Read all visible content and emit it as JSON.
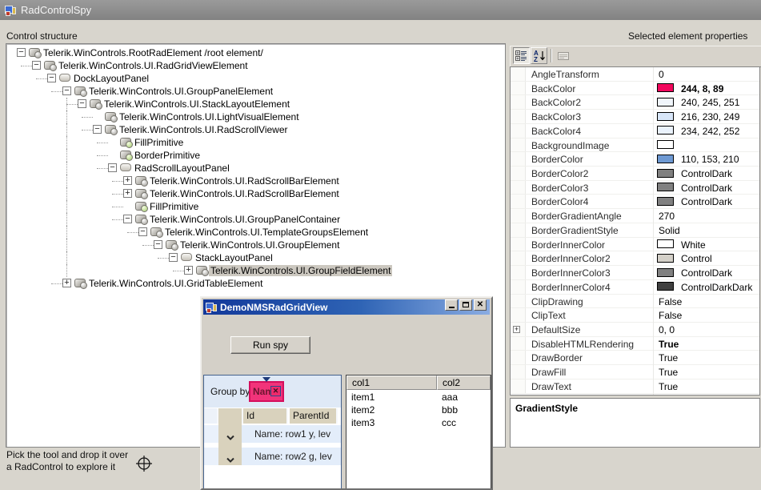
{
  "window": {
    "title": "RadControlSpy"
  },
  "labels": {
    "control_structure": "Control structure",
    "selected_properties": "Selected element properties"
  },
  "tree": {
    "nodes": [
      {
        "label": "Telerik.WinControls.RootRadElement /root element/",
        "level": 0,
        "state": "minus",
        "icon": "element"
      },
      {
        "label": "Telerik.WinControls.UI.RadGridViewElement",
        "level": 1,
        "state": "minus",
        "icon": "element"
      },
      {
        "label": "DockLayoutPanel",
        "level": 2,
        "state": "minus",
        "icon": "panel"
      },
      {
        "label": "Telerik.WinControls.UI.GroupPanelElement",
        "level": 3,
        "state": "minus",
        "icon": "element"
      },
      {
        "label": "Telerik.WinControls.UI.StackLayoutElement",
        "level": 4,
        "state": "minus",
        "icon": "element"
      },
      {
        "label": "Telerik.WinControls.UI.LightVisualElement",
        "level": 5,
        "state": "leaf",
        "icon": "element"
      },
      {
        "label": "Telerik.WinControls.UI.RadScrollViewer",
        "level": 5,
        "state": "minus",
        "icon": "element"
      },
      {
        "label": "FillPrimitive",
        "level": 6,
        "state": "leaf",
        "icon": "primitive"
      },
      {
        "label": "BorderPrimitive",
        "level": 6,
        "state": "leaf",
        "icon": "primitive"
      },
      {
        "label": "RadScrollLayoutPanel",
        "level": 6,
        "state": "minus",
        "icon": "panel"
      },
      {
        "label": "Telerik.WinControls.UI.RadScrollBarElement",
        "level": 7,
        "state": "plus",
        "icon": "element"
      },
      {
        "label": "Telerik.WinControls.UI.RadScrollBarElement",
        "level": 7,
        "state": "plus",
        "icon": "element"
      },
      {
        "label": "FillPrimitive",
        "level": 7,
        "state": "leaf",
        "icon": "primitive"
      },
      {
        "label": "Telerik.WinControls.UI.GroupPanelContainer",
        "level": 7,
        "state": "minus",
        "icon": "element"
      },
      {
        "label": "Telerik.WinControls.UI.TemplateGroupsElement",
        "level": 8,
        "state": "minus",
        "icon": "element"
      },
      {
        "label": "Telerik.WinControls.UI.GroupElement",
        "level": 9,
        "state": "minus",
        "icon": "element"
      },
      {
        "label": "StackLayoutPanel",
        "level": 10,
        "state": "minus",
        "icon": "panel"
      },
      {
        "label": "Telerik.WinControls.UI.GroupFieldElement",
        "level": 11,
        "state": "plus",
        "icon": "element",
        "selected": true
      },
      {
        "label": "Telerik.WinControls.UI.GridTableElement",
        "level": 3,
        "state": "plus",
        "icon": "element"
      }
    ]
  },
  "properties": {
    "rows": [
      {
        "name": "AngleTransform",
        "value": "0"
      },
      {
        "name": "BackColor",
        "swatch": "#f2075c",
        "value": "244, 8, 89",
        "bold": true
      },
      {
        "name": "BackColor2",
        "swatch": "#f0f5fb",
        "value": "240, 245, 251"
      },
      {
        "name": "BackColor3",
        "swatch": "#d8e6f9",
        "value": "216, 230, 249"
      },
      {
        "name": "BackColor4",
        "swatch": "#eaf2fc",
        "value": "234, 242, 252"
      },
      {
        "name": "BackgroundImage",
        "swatch": "#ffffff",
        "value": ""
      },
      {
        "name": "BorderColor",
        "swatch": "#6e99d2",
        "value": "110, 153, 210"
      },
      {
        "name": "BorderColor2",
        "swatch": "#808080",
        "value": "ControlDark"
      },
      {
        "name": "BorderColor3",
        "swatch": "#808080",
        "value": "ControlDark"
      },
      {
        "name": "BorderColor4",
        "swatch": "#808080",
        "value": "ControlDark"
      },
      {
        "name": "BorderGradientAngle",
        "value": "270"
      },
      {
        "name": "BorderGradientStyle",
        "value": "Solid"
      },
      {
        "name": "BorderInnerColor",
        "swatch": "#ffffff",
        "value": "White"
      },
      {
        "name": "BorderInnerColor2",
        "swatch": "#d4d0c8",
        "value": "Control"
      },
      {
        "name": "BorderInnerColor3",
        "swatch": "#808080",
        "value": "ControlDark"
      },
      {
        "name": "BorderInnerColor4",
        "swatch": "#404040",
        "value": "ControlDarkDark"
      },
      {
        "name": "ClipDrawing",
        "value": "False"
      },
      {
        "name": "ClipText",
        "value": "False"
      },
      {
        "name": "DefaultSize",
        "value": "0, 0",
        "expandable": true
      },
      {
        "name": "DisableHTMLRendering",
        "value": "True",
        "bold": true
      },
      {
        "name": "DrawBorder",
        "value": "True"
      },
      {
        "name": "DrawFill",
        "value": "True"
      },
      {
        "name": "DrawText",
        "value": "True"
      }
    ],
    "description_title": "GradientStyle"
  },
  "demo_window": {
    "title": "DemoNMSRadGridView",
    "run_button": "Run spy",
    "group_by_label": "Group by:",
    "group_chip": "Name",
    "grid": {
      "headers": [
        "",
        "",
        "Id",
        "ParentId"
      ],
      "group_rows": [
        "Name: row1 y, lev",
        "Name: row2 g, lev"
      ]
    },
    "listview": {
      "headers": [
        "col1",
        "col2"
      ],
      "rows": [
        [
          "item1",
          "aaa"
        ],
        [
          "item2",
          "bbb"
        ],
        [
          "item3",
          "ccc"
        ]
      ]
    }
  },
  "status": {
    "line1": "Pick the tool and drop it over",
    "line2": "a RadControl to explore it"
  },
  "colors": {
    "accent_pink": "#f2337a",
    "chip_border": "#d40e5c",
    "group_row_bg": "#e3edfa",
    "header_tan": "#d9d2bd",
    "selection_bg": "#ccc8c0",
    "demo_titlebar_left": "#12389a",
    "demo_titlebar_right": "#8aace2"
  }
}
